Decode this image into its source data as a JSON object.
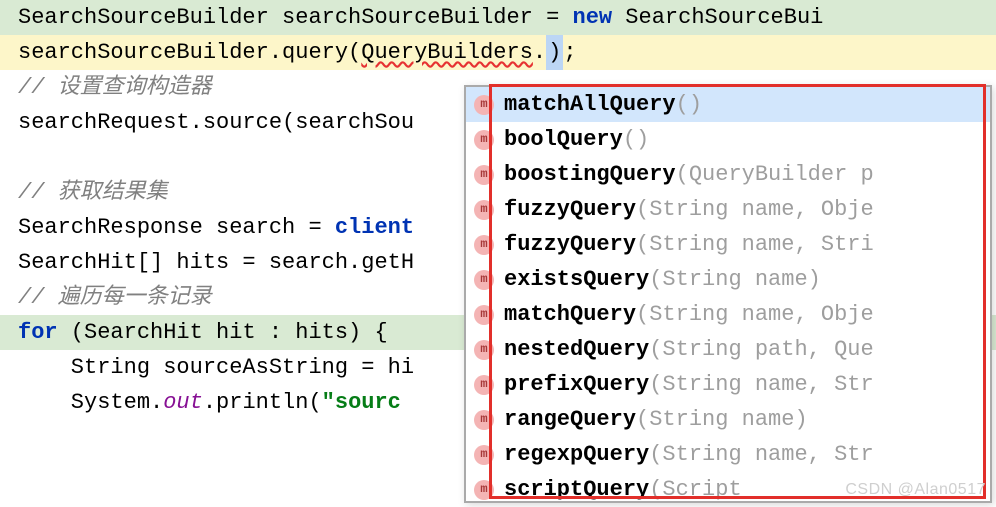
{
  "code": {
    "line1": {
      "t1": "SearchSourceBuilder searchSourceBuilder = ",
      "kwNew": "new",
      "t2": " SearchSourceBui"
    },
    "line2": {
      "t1": "searchSourceBuilder.query(",
      "qb": "QueryBuilders",
      "dot": ".",
      "cursor": ")",
      "t2": ");"
    },
    "line3": "// 设置查询构造器",
    "line4": {
      "t1": "searchRequest.source(searchSou"
    },
    "line5": "",
    "line6": "// 获取结果集",
    "line7": {
      "t1": "SearchResponse search = ",
      "client": "client"
    },
    "line8": {
      "t1": "SearchHit[] hits = search.getH"
    },
    "line9": "// 遍历每一条记录",
    "line10": {
      "kwFor": "for",
      "t1": " (SearchHit hit : hits) {"
    },
    "line11": {
      "t1": "    String sourceAsString = hi"
    },
    "line12": {
      "t1": "    System.",
      "out": "out",
      "t2": ".println(",
      "str": "\"sourc"
    }
  },
  "autocomplete": {
    "items": [
      {
        "name": "matchAllQuery",
        "params": "()"
      },
      {
        "name": "boolQuery",
        "params": "()"
      },
      {
        "name": "boostingQuery",
        "params": "(QueryBuilder p"
      },
      {
        "name": "fuzzyQuery",
        "params": "(String name, Obje"
      },
      {
        "name": "fuzzyQuery",
        "params": "(String name, Stri"
      },
      {
        "name": "existsQuery",
        "params": "(String name)"
      },
      {
        "name": "matchQuery",
        "params": "(String name, Obje"
      },
      {
        "name": "nestedQuery",
        "params": "(String path, Que"
      },
      {
        "name": "prefixQuery",
        "params": "(String name, Str"
      },
      {
        "name": "rangeQuery",
        "params": "(String name)"
      },
      {
        "name": "regexpQuery",
        "params": "(String name, Str"
      },
      {
        "name": "scriptQuery",
        "params": "(Script "
      }
    ],
    "iconLetter": "m"
  },
  "watermark": "CSDN @Alan0517"
}
